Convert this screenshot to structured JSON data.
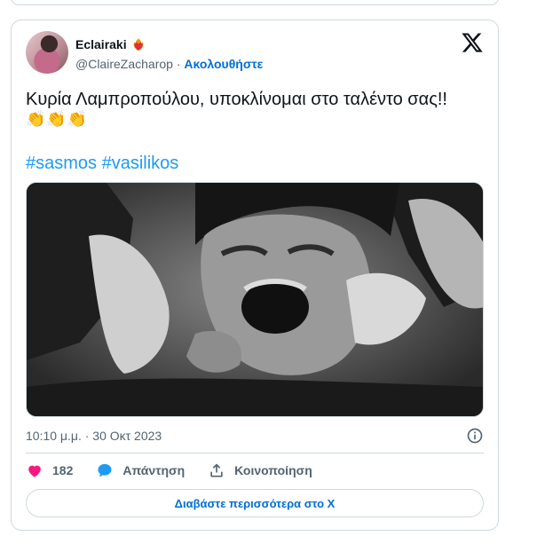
{
  "tweet": {
    "author_name": "Eclairaki",
    "author_handle": "@ClaireZacharop",
    "separator": "·",
    "follow_label": "Ακολουθήστε",
    "text": "Κυρία Λαμπροπούλου, υποκλίνομαι στο ταλέντο σας!!",
    "emojis": "👏👏👏",
    "hashtags": [
      "#sasmos",
      "#vasilikos"
    ],
    "timestamp": "10:10 μ.μ. · 30 Οκτ 2023"
  },
  "actions": {
    "like_count": "182",
    "reply_label": "Απάντηση",
    "share_label": "Κοινοποίηση"
  },
  "read_more_label": "Διαβάστε περισσότερα στο X",
  "icons": {
    "name_badge": "heart-fire-icon",
    "logo": "x-logo-icon",
    "info": "info-icon",
    "like": "heart-icon",
    "reply": "reply-bubble-icon",
    "share": "share-icon"
  },
  "colors": {
    "link": "#006fd6",
    "hashtag": "#1d9bf0",
    "like": "#f91880",
    "reply": "#1d9bf0",
    "muted": "#536471",
    "border": "#cfd9de"
  }
}
